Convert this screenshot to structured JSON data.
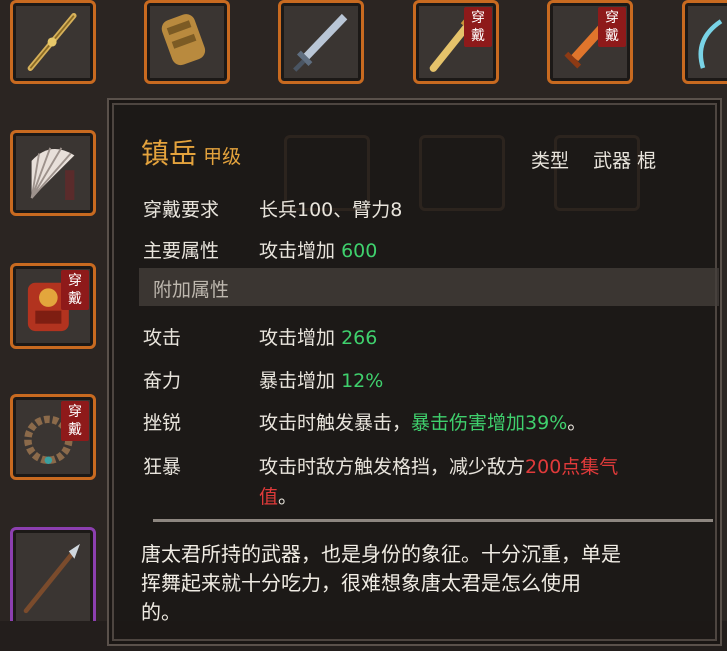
{
  "inventory": {
    "worn_label": "穿戴",
    "slots": [
      {
        "id": "spear-gold",
        "worn": false
      },
      {
        "id": "gauntlet",
        "worn": false
      },
      {
        "id": "sword-blue",
        "worn": false
      },
      {
        "id": "staff-gold",
        "worn": true
      },
      {
        "id": "sword-orange",
        "worn": true
      },
      {
        "id": "bow",
        "worn": false
      },
      {
        "id": "fan",
        "worn": false
      },
      {
        "id": "armor-red",
        "worn": true
      },
      {
        "id": "bead-necklace",
        "worn": true
      },
      {
        "id": "spear-purple",
        "worn": false
      }
    ]
  },
  "tooltip": {
    "name": "镇岳",
    "grade": "甲级",
    "type_label": "类型",
    "type_value": "武器 棍",
    "requirement_label": "穿戴要求",
    "requirement_value": "长兵100、臂力8",
    "main_attr_label": "主要属性",
    "main_attr_text": "攻击增加",
    "main_attr_value": "600",
    "extra_section": "附加属性",
    "extras": [
      {
        "label": "攻击",
        "text": "攻击增加",
        "value": "266"
      },
      {
        "label": "奋力",
        "text": "暴击增加",
        "value": "12%"
      }
    ],
    "skill1": {
      "label": "挫锐",
      "text": "攻击时触发暴击，",
      "highlight": "暴击伤害增加39%",
      "end": "。"
    },
    "skill2": {
      "label": "狂暴",
      "text": "攻击时敌方触发格挡，减少敌方",
      "highlight": "200点集气",
      "highlight2": "值",
      "end": "。"
    },
    "description_line1": "唐太君所持的武器，也是身份的象征。十分沉重，单是",
    "description_line2": "挥舞起来就十分吃力，很难想象唐太君是怎么使用",
    "description_line3": "的。"
  },
  "colors": {
    "slot_border": "#c86a20",
    "slot_border_rare": "#8c3fb0",
    "name": "#e4a33d",
    "positive": "#3fd06d",
    "negative": "#e03a3a",
    "badge": "#8e1a1a"
  }
}
